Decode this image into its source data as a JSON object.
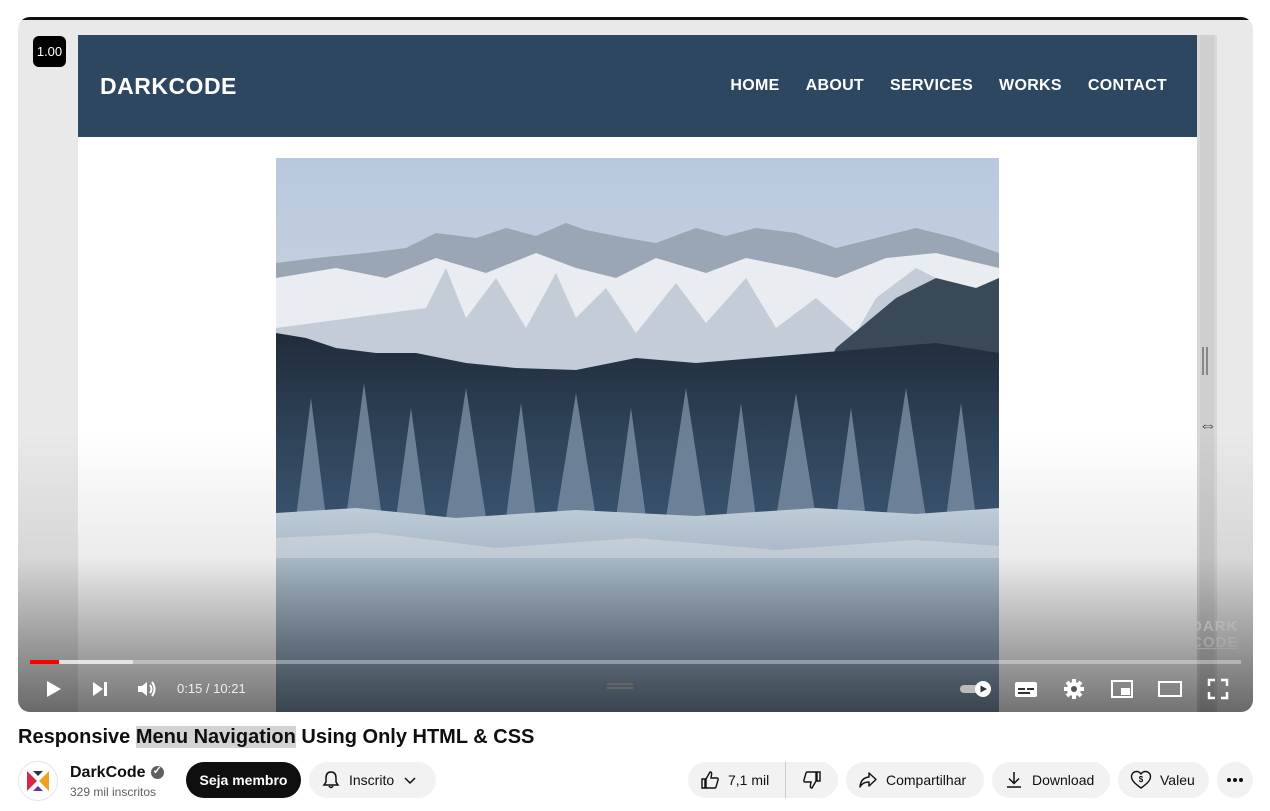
{
  "player": {
    "speed_badge": "1.00",
    "time_current": "0:15",
    "time_separator": " / ",
    "time_total": "10:21",
    "progress_played_fraction": 0.024,
    "progress_buffered_fraction": 0.085,
    "watermark_line1": "DARK",
    "watermark_line2": "CODE"
  },
  "site": {
    "logo": "DARKCODE",
    "menu": [
      "HOME",
      "ABOUT",
      "SERVICES",
      "WORKS",
      "CONTACT"
    ],
    "nav_color": "#2e4761"
  },
  "controls": {
    "icons": [
      "play-icon",
      "next-icon",
      "volume-icon",
      "autoplay-toggle",
      "subtitles-icon",
      "settings-gear-icon",
      "miniplayer-icon",
      "theater-mode-icon",
      "fullscreen-icon"
    ]
  },
  "video": {
    "title_before": "Responsive ",
    "title_highlight": "Menu Navigation",
    "title_after": " Using Only HTML & CSS"
  },
  "channel": {
    "name": "DarkCode",
    "subscribers": "329 mil inscritos"
  },
  "actions": {
    "join": "Seja membro",
    "subscribed": "Inscrito",
    "likes": "7,1 mil",
    "share": "Compartilhar",
    "download": "Download",
    "thanks": "Valeu"
  },
  "colors": {
    "progress_red": "#ff0000",
    "join_bg": "#0f0f0f"
  }
}
